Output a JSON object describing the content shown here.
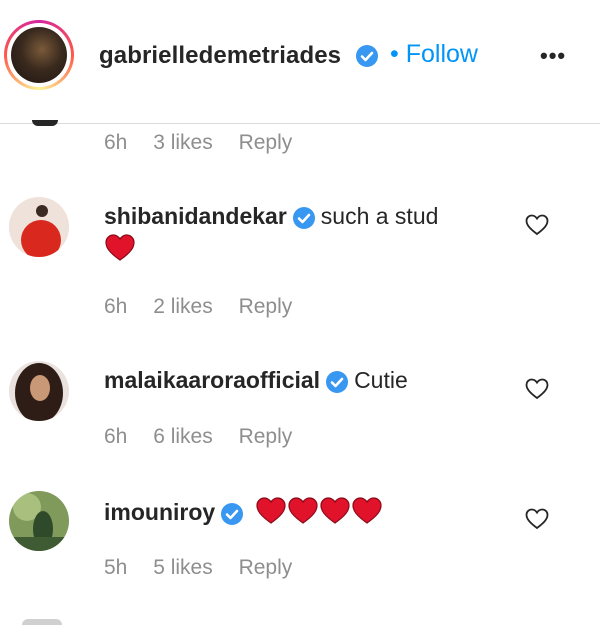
{
  "header": {
    "username": "gabrielledemetriades",
    "separator": "•",
    "follow_label": "Follow",
    "more_label": "•••"
  },
  "first_meta": {
    "time": "6h",
    "likes": "3 likes",
    "reply": "Reply"
  },
  "comments": [
    {
      "username": "shibanidandekar",
      "text": "such a stud",
      "second_line_emoji": "red-heart-emoji",
      "time": "6h",
      "likes": "2 likes",
      "reply": "Reply"
    },
    {
      "username": "malaikaaroraofficial",
      "text": "Cutie",
      "time": "6h",
      "likes": "6 likes",
      "reply": "Reply"
    },
    {
      "username": "imouniroy",
      "emoji_count": 4,
      "emoji": "red-heart-emoji",
      "time": "5h",
      "likes": "5 likes",
      "reply": "Reply"
    }
  ],
  "colors": {
    "verified_blue": "#3897f0",
    "follow_blue": "#0095f6",
    "meta_gray": "#8e8e8e",
    "heart_red": "#e0132b"
  }
}
